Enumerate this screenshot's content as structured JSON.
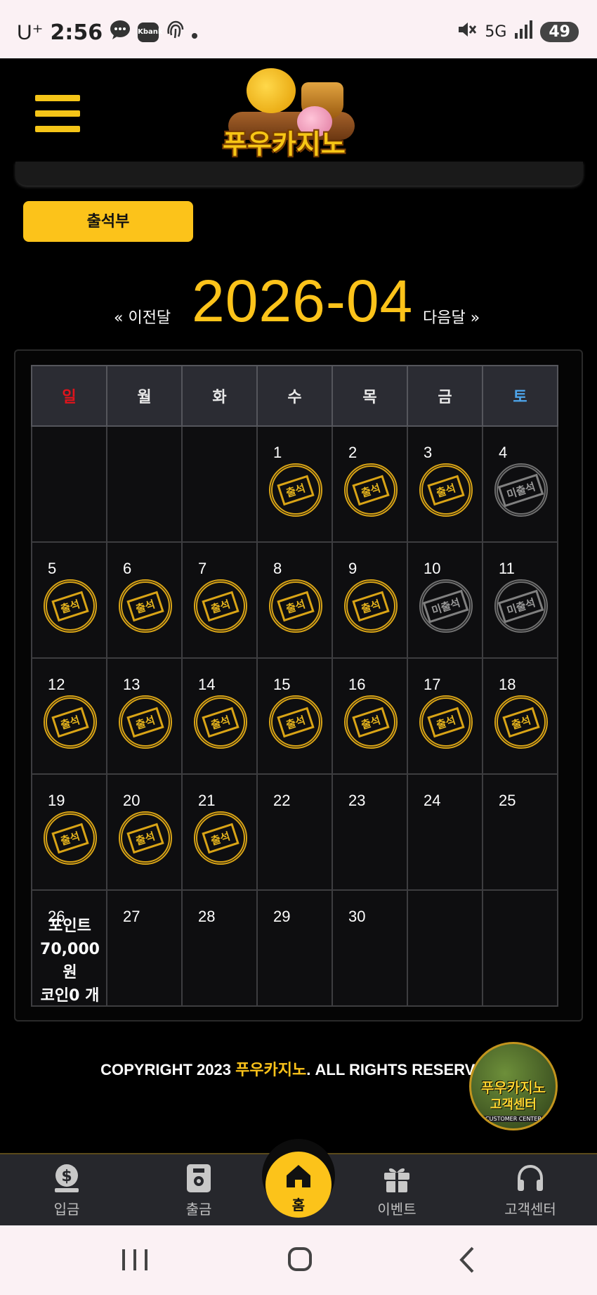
{
  "status_bar": {
    "carrier": "U⁺",
    "time": "2:56",
    "notification_icons": [
      "chat-icon",
      "kbank-icon",
      "fingerprint-icon",
      "dot-icon"
    ],
    "kbank_label": "Kbank",
    "network": "5G",
    "battery": "49"
  },
  "header": {
    "logo_text": "푸우카지노"
  },
  "attendance_button": "출석부",
  "month_nav": {
    "prev_label": "« 이전달",
    "current_month": "2026-04",
    "next_label": "다음달 »"
  },
  "calendar": {
    "weekdays": [
      "일",
      "월",
      "화",
      "수",
      "목",
      "금",
      "토"
    ],
    "stamp_present": "출석",
    "stamp_absent": "미출석",
    "weeks": [
      [
        null,
        null,
        null,
        {
          "day": "1",
          "status": "present"
        },
        {
          "day": "2",
          "status": "present"
        },
        {
          "day": "3",
          "status": "present"
        },
        {
          "day": "4",
          "status": "absent"
        }
      ],
      [
        {
          "day": "5",
          "status": "present"
        },
        {
          "day": "6",
          "status": "present"
        },
        {
          "day": "7",
          "status": "present"
        },
        {
          "day": "8",
          "status": "present"
        },
        {
          "day": "9",
          "status": "present"
        },
        {
          "day": "10",
          "status": "absent"
        },
        {
          "day": "11",
          "status": "absent"
        }
      ],
      [
        {
          "day": "12",
          "status": "present"
        },
        {
          "day": "13",
          "status": "present"
        },
        {
          "day": "14",
          "status": "present"
        },
        {
          "day": "15",
          "status": "present"
        },
        {
          "day": "16",
          "status": "present"
        },
        {
          "day": "17",
          "status": "present"
        },
        {
          "day": "18",
          "status": "present"
        }
      ],
      [
        {
          "day": "19",
          "status": "present"
        },
        {
          "day": "20",
          "status": "present"
        },
        {
          "day": "21",
          "status": "present"
        },
        {
          "day": "22",
          "status": "none"
        },
        {
          "day": "23",
          "status": "none"
        },
        {
          "day": "24",
          "status": "none"
        },
        {
          "day": "25",
          "status": "none"
        }
      ],
      [
        {
          "day": "26",
          "status": "today"
        },
        {
          "day": "27",
          "status": "none"
        },
        {
          "day": "28",
          "status": "none"
        },
        {
          "day": "29",
          "status": "none"
        },
        {
          "day": "30",
          "status": "none"
        },
        null,
        null
      ]
    ],
    "today_summary": {
      "point_label": "포인트",
      "point_value": "70,000 원",
      "coin_label": "코인",
      "coin_value": "0",
      "coin_unit": "개"
    }
  },
  "footer": {
    "copyright_prefix": "COPYRIGHT 2023 ",
    "brand": "푸우카지노",
    "copyright_suffix": ". ALL RIGHTS RESERVED"
  },
  "cs_badge": {
    "title": "푸우카지노",
    "subtitle": "고객센터",
    "caption": "CUSTOMER CENTER"
  },
  "bottom_nav": {
    "deposit": "입금",
    "withdraw": "출금",
    "home": "홈",
    "event": "이벤트",
    "support": "고객센터"
  },
  "colors": {
    "accent": "#fcc31a",
    "sunday": "#e0141c",
    "saturday": "#4ea6ec",
    "background": "#000000"
  }
}
